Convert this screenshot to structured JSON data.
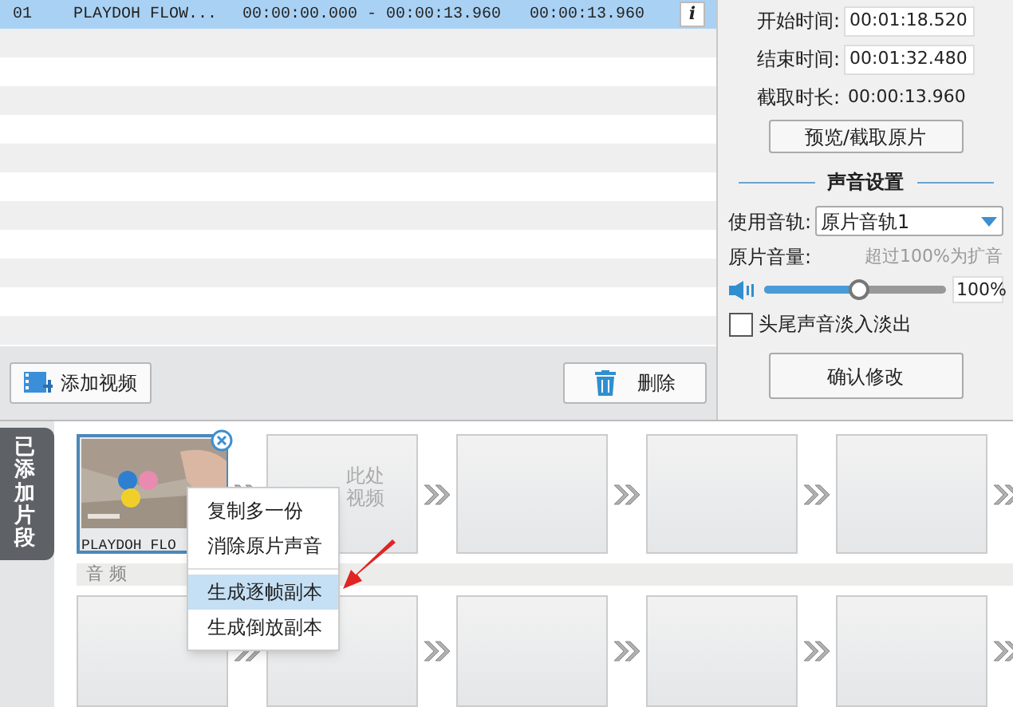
{
  "clip_table": {
    "rows": [
      {
        "index": "01",
        "name": "PLAYDOH FLOW...",
        "range": "00:00:00.000 - 00:00:13.960",
        "duration": "00:00:13.960",
        "selected": true,
        "info": "i"
      }
    ]
  },
  "toolbar": {
    "add": "添加视频",
    "delete": "删除"
  },
  "settings": {
    "start_label": "开始时间:",
    "start": "00:01:18.520",
    "end_label": "结束时间:",
    "end": "00:01:32.480",
    "length_label": "截取时长:",
    "length": "00:00:13.960",
    "preview_button": "预览/截取原片",
    "sound_header": "声音设置",
    "track_label": "使用音轨:",
    "track": "原片音轨1",
    "volume_label": "原片音量:",
    "volume_hint": "超过100%为扩音",
    "volume": {
      "level": 0.52
    },
    "volume_value": "100%",
    "fade_label": "头尾声音淡入淡出",
    "fade_checked": false,
    "confirm": "确认修改"
  },
  "clips_tab": "已添加片段",
  "video_slots": [
    {
      "kind": "clip",
      "title": "PLAYDOH FLO"
    },
    {
      "kind": "drop",
      "hint_1": "此处",
      "hint_2": "视频"
    },
    {
      "kind": "empty"
    },
    {
      "kind": "empty"
    },
    {
      "kind": "empty"
    }
  ],
  "audio_label": "音 频",
  "context_menu": [
    {
      "label": "复制多一份",
      "selected": false,
      "divider_after": false
    },
    {
      "label": "消除原片声音",
      "selected": false,
      "divider_after": true
    },
    {
      "label": "生成逐帧副本",
      "selected": true,
      "divider_after": false
    },
    {
      "label": "生成倒放副本",
      "selected": false,
      "divider_after": false
    }
  ]
}
